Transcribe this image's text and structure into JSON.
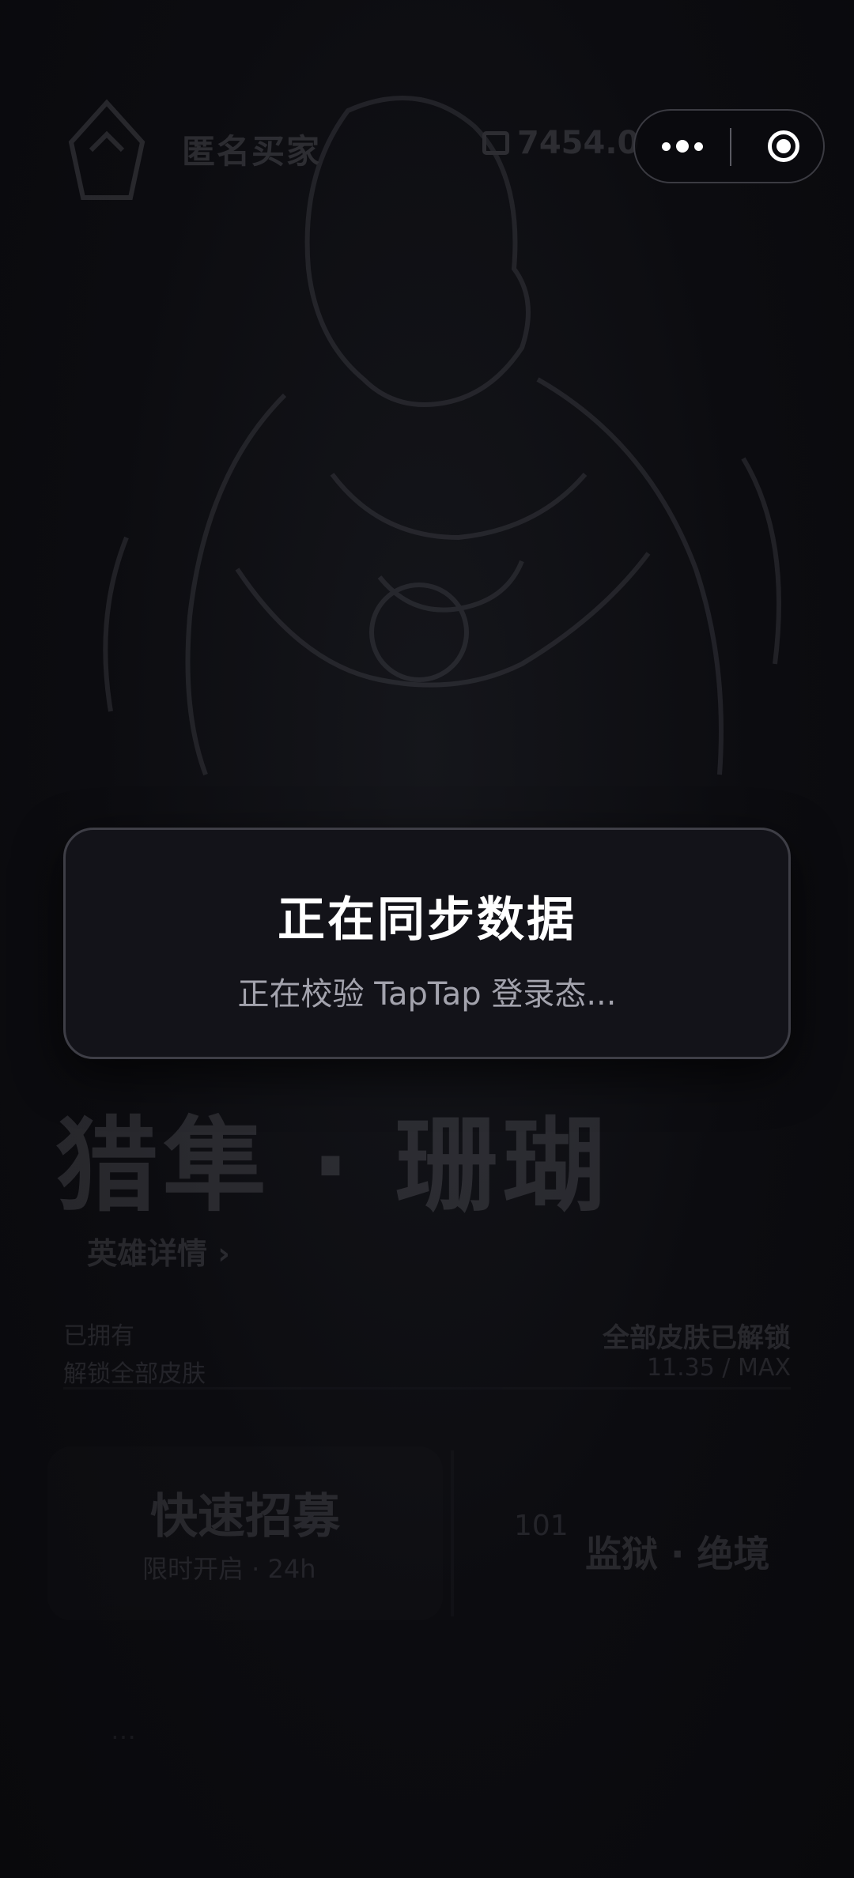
{
  "background": {
    "nickname": "匿名买家",
    "balance": "7454.0",
    "wallet_icon": "wallet-icon",
    "hero_title": "猎隼 · 珊瑚",
    "details_link": "英雄详情 ›",
    "info_left_line1": "已拥有",
    "info_left_line2": "解锁全部皮肤",
    "info_right_line1": "全部皮肤已解锁",
    "info_right_line2": "11.35 / MAX",
    "card_left_title": "快速招募",
    "card_left_subtitle": "限时开启 · 24h",
    "card_right_label": "101",
    "card_right_title": "监狱 · 绝境",
    "bottom_text": "…"
  },
  "capsule": {
    "more_icon": "more-dots-icon",
    "close_icon": "close-circle-icon"
  },
  "modal": {
    "title": "正在同步数据",
    "message": "正在校验 TapTap 登录态..."
  },
  "colors": {
    "background": "#0b0b0f",
    "modal_bg": "#131319",
    "modal_border": "#3e3e46",
    "title": "#ffffff",
    "subtitle": "#a3a3ad"
  }
}
